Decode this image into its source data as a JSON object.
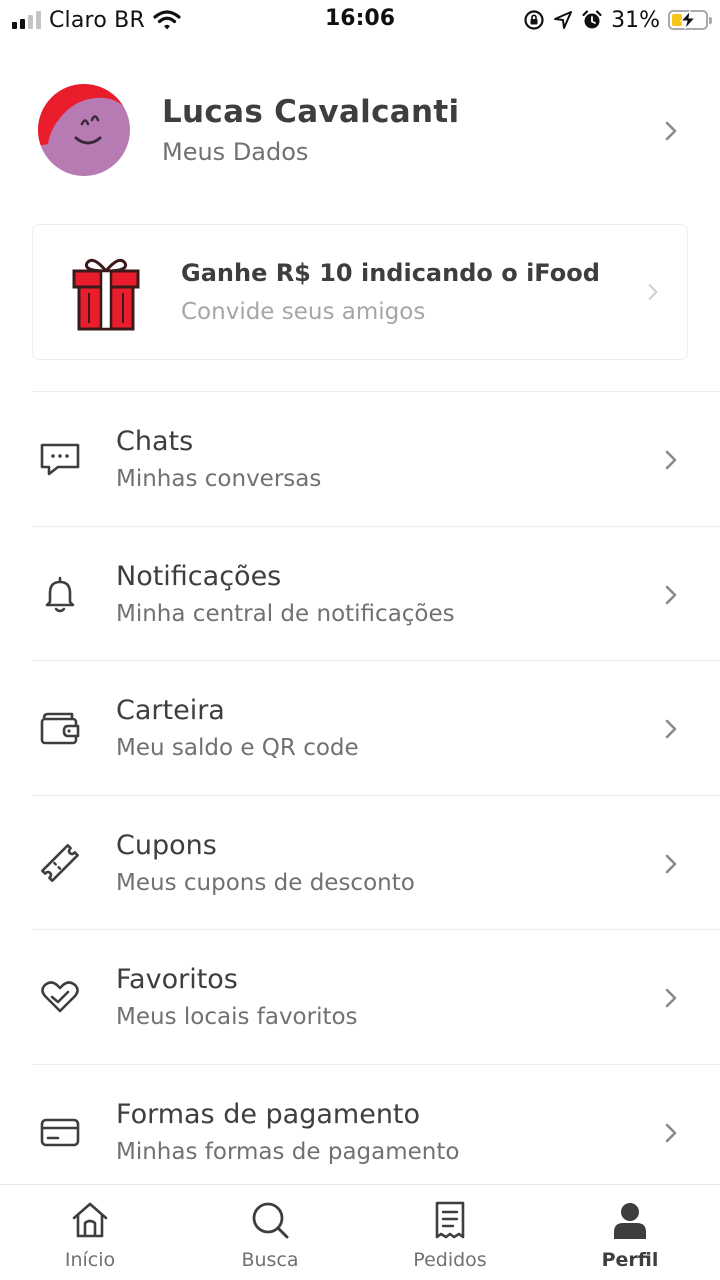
{
  "status_bar": {
    "carrier": "Claro BR",
    "time": "16:06",
    "battery": "31%",
    "battery_level": 0.31,
    "icons": [
      "signal-icon",
      "wifi-icon",
      "screen-lock-icon",
      "location-icon",
      "alarm-icon",
      "battery-icon"
    ]
  },
  "profile": {
    "name": "Lucas Cavalcanti",
    "subtitle": "Meus Dados"
  },
  "invite": {
    "title": "Ganhe R$ 10 indicando o iFood",
    "subtitle": "Convide seus amigos",
    "icon": "gift-icon"
  },
  "menu": [
    {
      "title": "Chats",
      "subtitle": "Minhas conversas",
      "icon": "chat-icon"
    },
    {
      "title": "Notificações",
      "subtitle": "Minha central de notificações",
      "icon": "bell-icon"
    },
    {
      "title": "Carteira",
      "subtitle": "Meu saldo e QR code",
      "icon": "wallet-icon"
    },
    {
      "title": "Cupons",
      "subtitle": "Meus cupons de desconto",
      "icon": "ticket-icon"
    },
    {
      "title": "Favoritos",
      "subtitle": "Meus locais favoritos",
      "icon": "heart-icon"
    },
    {
      "title": "Formas de pagamento",
      "subtitle": "Minhas formas de pagamento",
      "icon": "credit-card-icon"
    }
  ],
  "tabs": [
    {
      "label": "Início",
      "icon": "home-icon",
      "active": false
    },
    {
      "label": "Busca",
      "icon": "search-icon",
      "active": false
    },
    {
      "label": "Pedidos",
      "icon": "orders-icon",
      "active": false
    },
    {
      "label": "Perfil",
      "icon": "profile-icon",
      "active": true
    }
  ],
  "colors": {
    "brand_red": "#ea1d2c",
    "avatar_purple": "#b77bb4",
    "text_primary": "#3e3e3e",
    "text_secondary": "#717171"
  }
}
